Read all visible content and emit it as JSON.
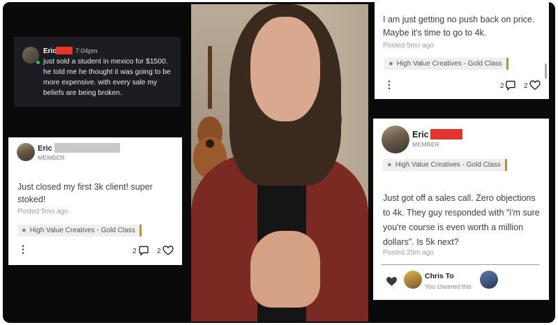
{
  "chat": {
    "name": "Eric",
    "time": "7:04pm",
    "message": "just sold a student in mexico for $1500. he told me he thought it was going to be more expensive. with every sale my beliefs are being broken."
  },
  "left_card": {
    "name": "Eric",
    "role": "MEMBER",
    "text": "Just closed my first 3k client! super stoked!",
    "posted": "Posted 5mo ago",
    "tag": "High Value Creatives - Gold Class",
    "comments": "2",
    "likes": "2"
  },
  "top_right_card": {
    "text": "I am just getting no push back on price. Maybe it's time to go to 4k.",
    "posted": "Posted 5mo ago",
    "tag": "High Value Creatives - Gold Class",
    "comments": "2",
    "likes": "2"
  },
  "bottom_right_card": {
    "name": "Eric",
    "role": "MEMBER",
    "tag": "High Value Creatives - Gold Class",
    "text": "Just got off a sales call. Zero objections to 4k. They guy responded with \"i'm sure you're course is even worth a million dollars\". Is 5k next?",
    "posted": "Posted 20m ago",
    "cheer_name": "Chris To",
    "cheer_text": "You cheered this"
  },
  "icons": {
    "menu": "kebab-menu-icon",
    "comment": "comment-icon",
    "like": "heart-icon",
    "tag": "course-badge-icon"
  },
  "colors": {
    "redaction_red": "#e5342b",
    "tag_accent": "#b8913e",
    "online_green": "#2ecc40"
  }
}
